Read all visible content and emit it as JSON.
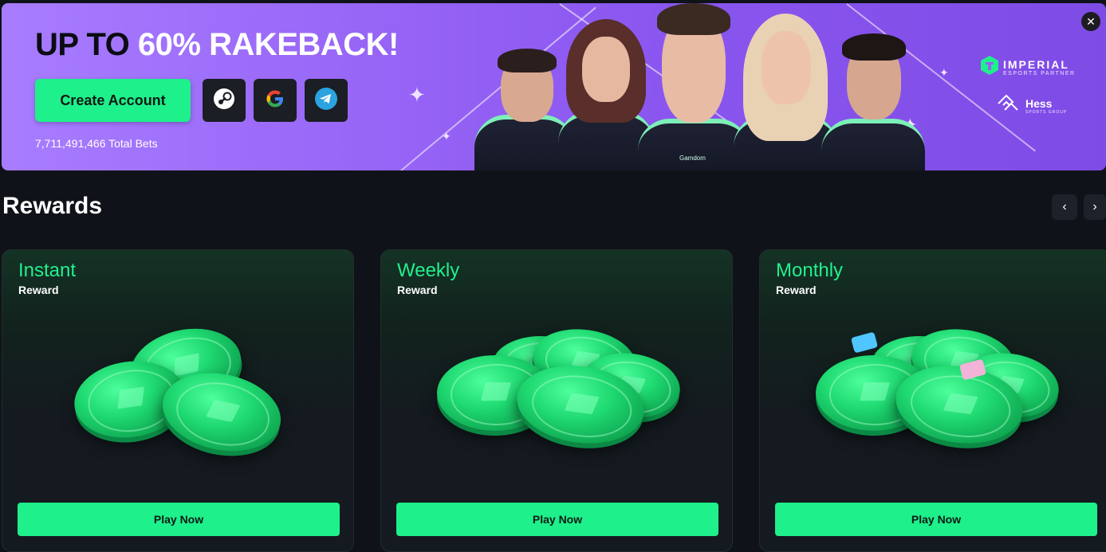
{
  "banner": {
    "title_prefix": "UP TO ",
    "title_highlight": "60% RAKEBACK!",
    "create_account_label": "Create Account",
    "total_bets": "7,711,491,466 Total Bets",
    "jersey_brand": "Gamdom",
    "partners": [
      {
        "name": "IMPERIAL",
        "subtitle": "ESPORTS PARTNER",
        "icon": "imperial-logo-icon",
        "color": "#1ef08b"
      },
      {
        "name": "Hess",
        "subtitle": "SPORTS GROUP",
        "icon": "hess-logo-icon"
      }
    ],
    "social_buttons": [
      {
        "name": "steam",
        "icon": "steam-icon"
      },
      {
        "name": "google",
        "icon": "google-icon"
      },
      {
        "name": "telegram",
        "icon": "telegram-icon"
      }
    ],
    "close_icon": "close-icon"
  },
  "rewards": {
    "title": "Rewards",
    "prev_icon": "chevron-left-icon",
    "next_icon": "chevron-right-icon",
    "cards": [
      {
        "title": "Instant",
        "subtitle": "Reward",
        "button": "Play Now"
      },
      {
        "title": "Weekly",
        "subtitle": "Reward",
        "button": "Play Now"
      },
      {
        "title": "Monthly",
        "subtitle": "Reward",
        "button": "Play Now"
      }
    ]
  },
  "colors": {
    "accent": "#1ef08b",
    "banner_purple": "#9461f5",
    "background": "#0f1319"
  }
}
